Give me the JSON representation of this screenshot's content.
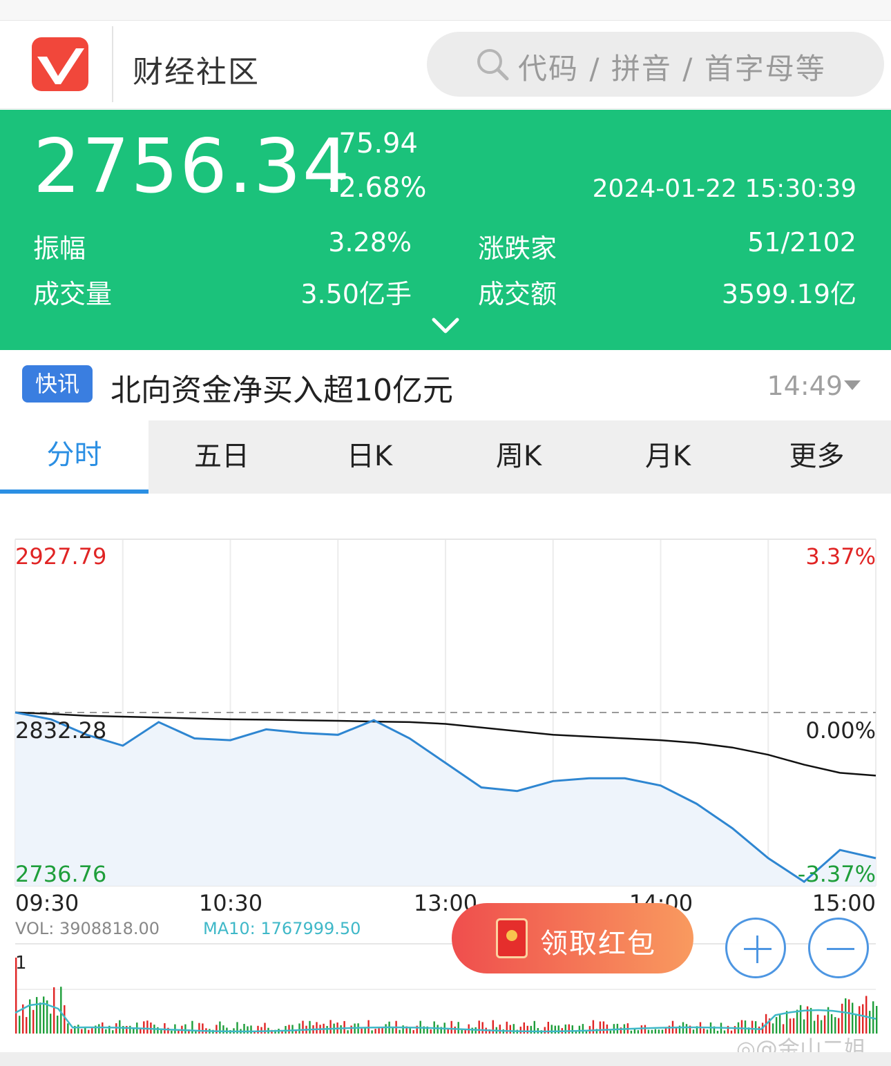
{
  "app": {
    "title": "财经社区",
    "search_placeholder": "代码 / 拼音 / 首字母等",
    "brand_color": "#f1473b"
  },
  "quote": {
    "price": "2756.34",
    "change": "-75.94",
    "change_pct": "-2.68%",
    "datetime": "2024-01-22 15:30:39",
    "color": "#1bc27b",
    "stats": [
      {
        "label": "振幅",
        "value": "3.28%"
      },
      {
        "label": "涨跌家",
        "value": "51/2102"
      },
      {
        "label": "成交量",
        "value": "3.50亿手"
      },
      {
        "label": "成交额",
        "value": "3599.19亿"
      }
    ]
  },
  "news": {
    "badge": "快讯",
    "headline": "北向资金净买入超10亿元",
    "time": "14:49"
  },
  "tabs": [
    {
      "label": "分时",
      "active": true
    },
    {
      "label": "五日",
      "active": false
    },
    {
      "label": "日K",
      "active": false
    },
    {
      "label": "周K",
      "active": false
    },
    {
      "label": "月K",
      "active": false
    },
    {
      "label": "更多",
      "active": false
    }
  ],
  "chart": {
    "price_high": "2927.79",
    "price_mid": "2832.28",
    "price_low": "2736.76",
    "pct_high": "3.37%",
    "pct_mid": "0.00%",
    "pct_low": "-3.37%",
    "time_labels": [
      "09:30",
      "10:30",
      "13:00",
      "14:00",
      "15:00"
    ],
    "vol_label": "VOL: 3908818.00",
    "ma_label": "MA10: 1767999.50",
    "vol_axis_label": "1"
  },
  "chart_data": {
    "type": "line",
    "x": [
      "09:30",
      "09:40",
      "09:50",
      "10:00",
      "10:10",
      "10:20",
      "10:30",
      "10:40",
      "10:50",
      "11:00",
      "11:10",
      "11:20",
      "11:30",
      "13:10",
      "13:20",
      "13:30",
      "13:40",
      "13:50",
      "14:00",
      "14:10",
      "14:20",
      "14:30",
      "14:40",
      "14:50",
      "15:00"
    ],
    "series": [
      {
        "values": [
          2832.3,
          2828.5,
          2820.0,
          2814.0,
          2827.0,
          2818.0,
          2817.0,
          2823.0,
          2821.0,
          2820.0,
          2828.0,
          2818.0,
          2804.5,
          2791.0,
          2789.0,
          2794.5,
          2796.0,
          2796.0,
          2792.0,
          2782.0,
          2768.5,
          2752.0,
          2739.0,
          2756.5,
          2752.0
        ]
      },
      {
        "values": [
          2832.3,
          2831.5,
          2830.5,
          2830.0,
          2829.5,
          2829.0,
          2828.5,
          2828.3,
          2828.0,
          2827.7,
          2827.3,
          2827.0,
          2826.0,
          2824.0,
          2822.0,
          2820.0,
          2819.0,
          2818.0,
          2817.0,
          2815.5,
          2813.0,
          2809.0,
          2803.5,
          2799.0,
          2797.5
        ]
      }
    ],
    "ylim": [
      2736.76,
      2927.79
    ],
    "colors": {
      "price": "#2e86d1",
      "average": "#111111",
      "up": "#e02424",
      "down": "#1e9e3a",
      "ma": "#3fb8c8"
    }
  }
}
